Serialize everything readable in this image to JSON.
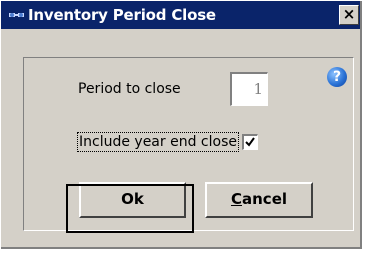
{
  "window": {
    "title": "Inventory Period Close",
    "close_label": "×",
    "help_label": "?"
  },
  "form": {
    "period_label": "Period to close",
    "period_value": "1",
    "year_end_label": "Include year end close",
    "year_end_checked": true
  },
  "buttons": {
    "ok_label": "Ok",
    "cancel_label": "ancel",
    "cancel_accel": "C"
  },
  "colors": {
    "titlebar": "#0a246a",
    "face": "#d4d0c8",
    "help": "#2b73d6"
  }
}
